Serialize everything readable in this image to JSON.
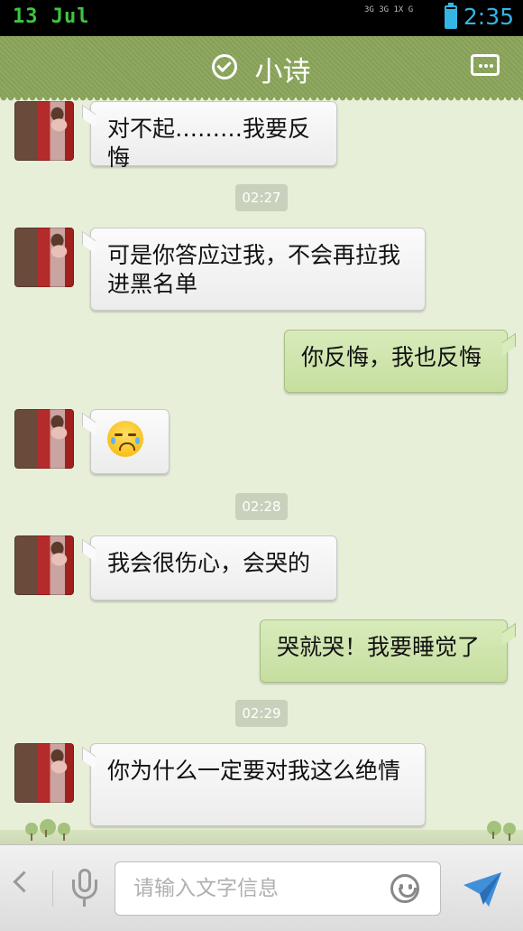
{
  "status_bar": {
    "date": "13 Jul",
    "signal_text": "3G 3G 1X G",
    "time": "2:35"
  },
  "header": {
    "title": "小诗",
    "verified_icon": "check-circle-icon",
    "more_icon": "more-options-icon"
  },
  "messages": [
    {
      "side": "left",
      "text": "对不起………我要反悔"
    },
    {
      "timestamp": "02:27"
    },
    {
      "side": "left",
      "text": "可是你答应过我，不会再拉我进黑名单"
    },
    {
      "side": "right",
      "text": "你反悔，我也反悔"
    },
    {
      "side": "left",
      "emoji": "crying-face-emoji"
    },
    {
      "timestamp": "02:28"
    },
    {
      "side": "left",
      "text": "我会很伤心，会哭的"
    },
    {
      "side": "right",
      "text": "哭就哭！我要睡觉了"
    },
    {
      "timestamp": "02:29"
    },
    {
      "side": "left",
      "text": "你为什么一定要对我这么绝情"
    }
  ],
  "input_bar": {
    "placeholder": "请输入文字信息",
    "value": ""
  },
  "colors": {
    "header_green": "#8aa45a",
    "status_time_blue": "#34b5e5",
    "status_date_green": "#3ec63e",
    "outgoing_bubble": "#d0e6ac",
    "incoming_bubble": "#f7f7f7",
    "chat_background": "#e8efd9"
  }
}
